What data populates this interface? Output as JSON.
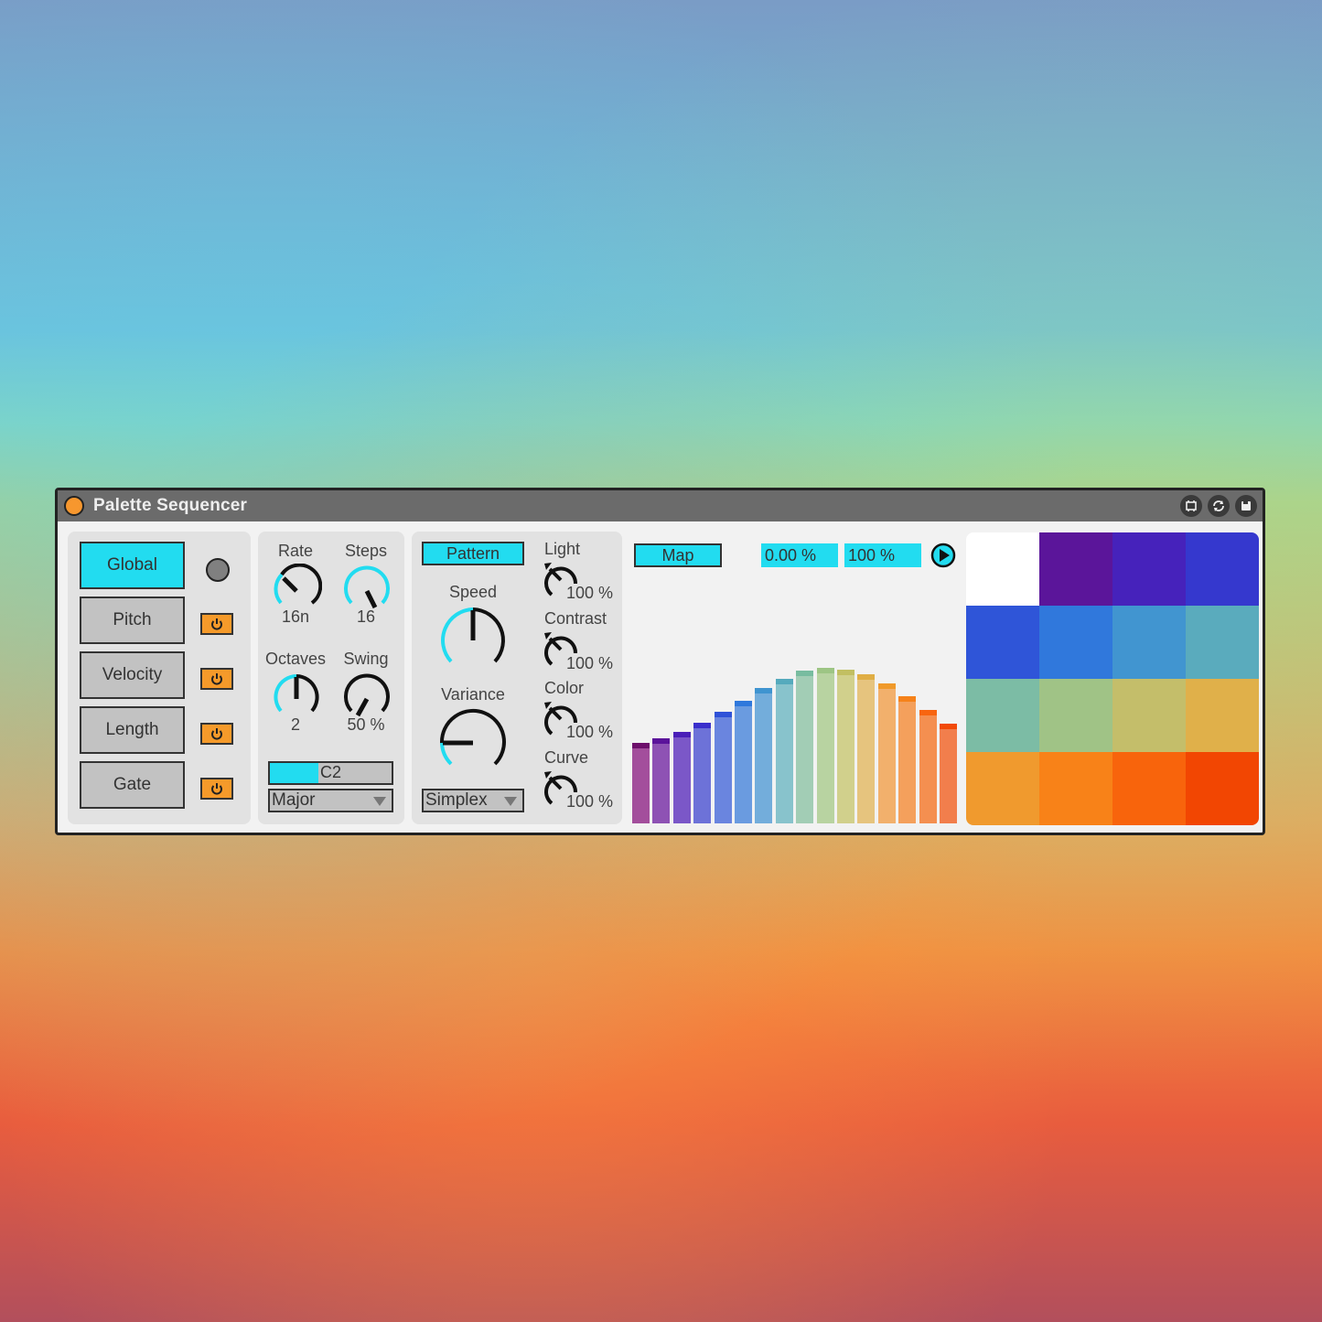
{
  "window": {
    "title": "Palette Sequencer",
    "title_dot_color": "#f7972e",
    "icons": [
      "fold-icon",
      "refresh-icon",
      "save-icon"
    ]
  },
  "global_panel": {
    "tabs": [
      {
        "label": "Global",
        "active": true,
        "control": "led"
      },
      {
        "label": "Pitch",
        "active": false,
        "control": "power"
      },
      {
        "label": "Velocity",
        "active": false,
        "control": "power"
      },
      {
        "label": "Length",
        "active": false,
        "control": "power"
      },
      {
        "label": "Gate",
        "active": false,
        "control": "power"
      }
    ]
  },
  "timing_panel": {
    "rate": {
      "label": "Rate",
      "value": "16n"
    },
    "steps": {
      "label": "Steps",
      "value": "16"
    },
    "octaves": {
      "label": "Octaves",
      "value": "2"
    },
    "swing": {
      "label": "Swing",
      "value": "50 %"
    },
    "root_note": {
      "value": "C2",
      "fill_fraction": 0.4
    },
    "scale": {
      "value": "Major"
    }
  },
  "pattern_panel": {
    "pattern_button": "Pattern",
    "speed": {
      "label": "Speed"
    },
    "variance": {
      "label": "Variance"
    },
    "noise_type": {
      "value": "Simplex"
    },
    "light": {
      "label": "Light",
      "value": "100 %"
    },
    "contrast": {
      "label": "Contrast",
      "value": "100 %"
    },
    "color": {
      "label": "Color",
      "value": "100 %"
    },
    "curve": {
      "label": "Curve",
      "value": "100 %"
    }
  },
  "map_panel": {
    "map_button": "Map",
    "min_value": "0.00 %",
    "max_value": "100 %",
    "bars": [
      {
        "value": 0.52,
        "color": "#a34e9c",
        "cap": "#6d0f6b"
      },
      {
        "value": 0.55,
        "color": "#8e52b4",
        "cap": "#5b139a"
      },
      {
        "value": 0.59,
        "color": "#7b57c8",
        "cap": "#4a1fb8"
      },
      {
        "value": 0.65,
        "color": "#6d72d8",
        "cap": "#3a2fcc"
      },
      {
        "value": 0.72,
        "color": "#6a85df",
        "cap": "#2f52d8"
      },
      {
        "value": 0.79,
        "color": "#6a9be0",
        "cap": "#2f78dc"
      },
      {
        "value": 0.87,
        "color": "#73addb",
        "cap": "#3f94d0"
      },
      {
        "value": 0.93,
        "color": "#88c3cc",
        "cap": "#55aabd"
      },
      {
        "value": 0.98,
        "color": "#a2cdb5",
        "cap": "#78bca0"
      },
      {
        "value": 1.0,
        "color": "#b8d3a1",
        "cap": "#9dc584"
      },
      {
        "value": 0.99,
        "color": "#d1d08c",
        "cap": "#c2bf62"
      },
      {
        "value": 0.96,
        "color": "#e6c47e",
        "cap": "#e0ae45"
      },
      {
        "value": 0.9,
        "color": "#f2b06c",
        "cap": "#f09a2a"
      },
      {
        "value": 0.82,
        "color": "#f4a05c",
        "cap": "#f6821a"
      },
      {
        "value": 0.73,
        "color": "#f48f50",
        "cap": "#f86510"
      },
      {
        "value": 0.64,
        "color": "#f27e4c",
        "cap": "#f24a08"
      }
    ]
  },
  "palette_grid": {
    "cells": [
      "#ffffff",
      "#5b159a",
      "#4622bb",
      "#3538ce",
      "#2f55d8",
      "#3078dc",
      "#4195d0",
      "#5aabbd",
      "#7cbca5",
      "#a0c386",
      "#c4be6a",
      "#e0b04a",
      "#f09a2e",
      "#f88218",
      "#f8640c",
      "#f24602"
    ]
  },
  "colors": {
    "accent": "#22dcf0",
    "power": "#f59a2a",
    "knob_track": "#111111"
  }
}
